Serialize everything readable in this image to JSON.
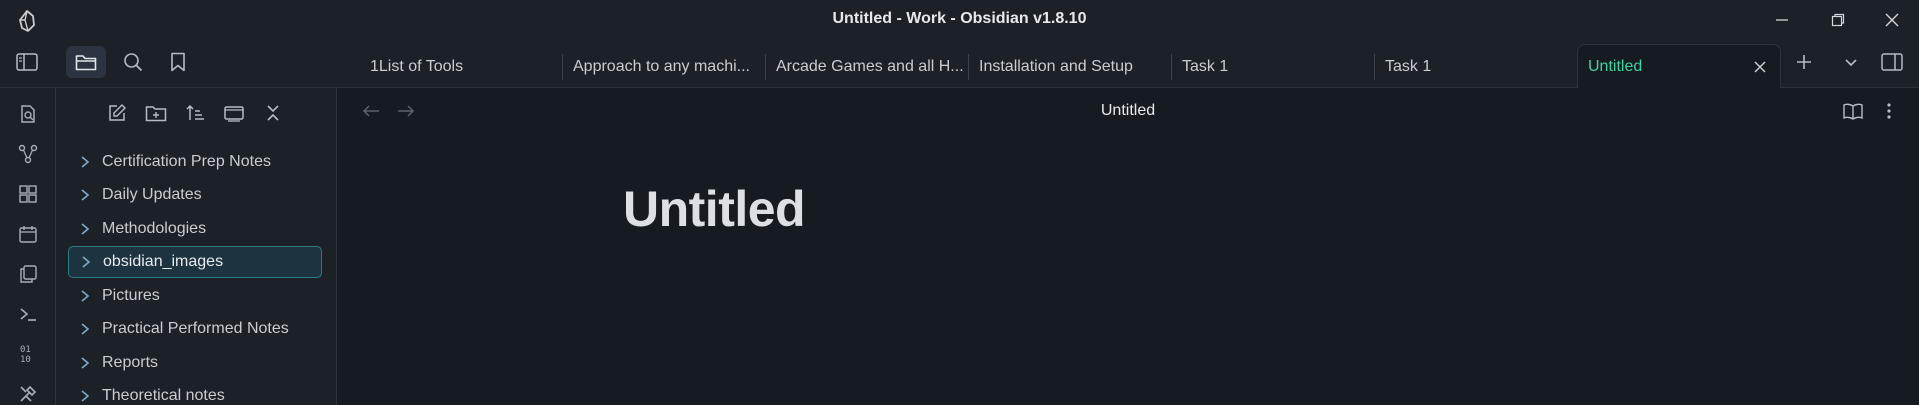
{
  "window": {
    "title": "Untitled - Work - Obsidian v1.8.10"
  },
  "colors": {
    "accent": "#3fd3a0",
    "background": "#161b22",
    "panel": "#1c2128",
    "selection": "#1d3440",
    "selection_border": "#2e7a80"
  },
  "toolbar": {
    "icons": [
      "sidebar-toggle-icon",
      "folder-icon",
      "search-icon",
      "bookmark-icon"
    ]
  },
  "tabs": [
    {
      "label": "1List of Tools"
    },
    {
      "label": "Approach to any machi..."
    },
    {
      "label": "Arcade Games and all H..."
    },
    {
      "label": "Installation and Setup"
    },
    {
      "label": "Task 1"
    },
    {
      "label": "Task 1"
    },
    {
      "label": "Untitled",
      "active": true
    }
  ],
  "ribbon": {
    "icons": [
      "open-quick-switcher-icon",
      "graph-view-icon",
      "canvas-icon",
      "daily-note-icon",
      "templates-icon",
      "command-palette-icon",
      "binary-icon",
      "tools-icon"
    ]
  },
  "explorer": {
    "tools": [
      "new-note-icon",
      "new-folder-icon",
      "sort-icon",
      "auto-reveal-icon",
      "collapse-all-icon"
    ],
    "folders": [
      {
        "label": "Certification Prep Notes"
      },
      {
        "label": "Daily Updates"
      },
      {
        "label": "Methodologies"
      },
      {
        "label": "obsidian_images",
        "selected": true
      },
      {
        "label": "Pictures"
      },
      {
        "label": "Practical Performed Notes"
      },
      {
        "label": "Reports"
      },
      {
        "label": "Theoretical notes"
      }
    ]
  },
  "editor": {
    "header_title": "Untitled",
    "document_title": "Untitled"
  }
}
